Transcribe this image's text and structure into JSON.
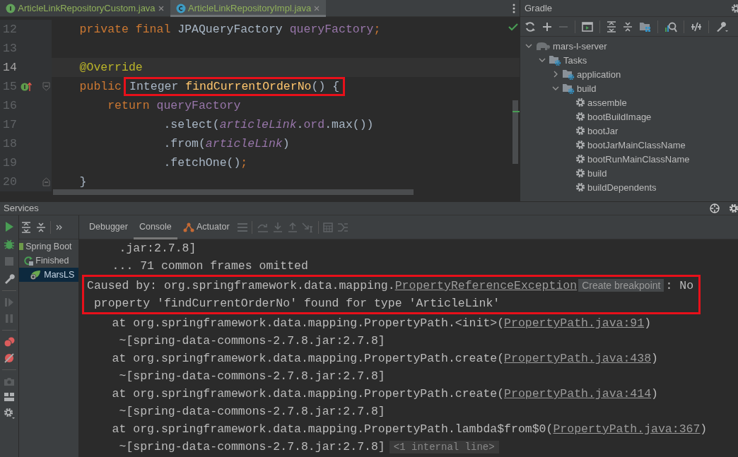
{
  "editor": {
    "tabs": [
      {
        "label": "ArticleLinkRepositoryCustom.java",
        "kind": "interface",
        "selected": false
      },
      {
        "label": "ArticleLinkRepositoryImpl.java",
        "kind": "class",
        "selected": true
      }
    ],
    "lines": [
      {
        "number": "12",
        "current": false,
        "implements": false,
        "fold_start": false,
        "fold_end": false,
        "segments": [
          {
            "boxed": false,
            "tokens": [
              {
                "text": "    private final ",
                "kind": "keyword"
              },
              {
                "text": "JPAQueryFactory ",
                "kind": "plain"
              },
              {
                "text": "queryFactory",
                "kind": "field"
              },
              {
                "text": ";",
                "kind": "keyword"
              }
            ]
          }
        ]
      },
      {
        "number": "13",
        "current": false,
        "implements": false,
        "fold_start": false,
        "fold_end": false
      },
      {
        "number": "14",
        "current": true,
        "implements": false,
        "fold_start": false,
        "fold_end": false,
        "segments": [
          {
            "boxed": false,
            "tokens": [
              {
                "text": "    @Override",
                "kind": "annotation"
              }
            ]
          }
        ]
      },
      {
        "number": "15",
        "current": false,
        "implements": true,
        "fold_start": true,
        "fold_end": false,
        "segments": [
          {
            "boxed": false,
            "tokens": [
              {
                "text": "    public",
                "kind": "keyword"
              }
            ]
          },
          {
            "boxed": true,
            "tokens": [
              {
                "text": "Integer ",
                "kind": "plain"
              },
              {
                "text": "findCurrentOrderNo",
                "kind": "method"
              },
              {
                "text": "() {",
                "kind": "plain"
              }
            ]
          }
        ]
      },
      {
        "number": "16",
        "current": false,
        "implements": false,
        "fold_start": false,
        "fold_end": false,
        "segments": [
          {
            "boxed": false,
            "tokens": [
              {
                "text": "        return ",
                "kind": "keyword"
              },
              {
                "text": "queryFactory",
                "kind": "field"
              }
            ]
          }
        ]
      },
      {
        "number": "17",
        "current": false,
        "implements": false,
        "fold_start": false,
        "fold_end": false,
        "segments": [
          {
            "boxed": false,
            "tokens": [
              {
                "text": "                .select(",
                "kind": "plain"
              },
              {
                "text": "articleLink",
                "kind": "static"
              },
              {
                "text": ".",
                "kind": "plain"
              },
              {
                "text": "ord",
                "kind": "field"
              },
              {
                "text": ".max())",
                "kind": "plain"
              }
            ]
          }
        ]
      },
      {
        "number": "18",
        "current": false,
        "implements": false,
        "fold_start": false,
        "fold_end": false,
        "segments": [
          {
            "boxed": false,
            "tokens": [
              {
                "text": "                .from(",
                "kind": "plain"
              },
              {
                "text": "articleLink",
                "kind": "static"
              },
              {
                "text": ")",
                "kind": "plain"
              }
            ]
          }
        ]
      },
      {
        "number": "19",
        "current": false,
        "implements": false,
        "fold_start": false,
        "fold_end": false,
        "segments": [
          {
            "boxed": false,
            "tokens": [
              {
                "text": "                .fetchOne()",
                "kind": "plain"
              },
              {
                "text": ";",
                "kind": "keyword"
              }
            ]
          }
        ]
      },
      {
        "number": "20",
        "current": false,
        "implements": false,
        "fold_start": false,
        "fold_end": true,
        "segments": [
          {
            "boxed": false,
            "tokens": [
              {
                "text": "    }",
                "kind": "plain"
              }
            ]
          }
        ]
      }
    ]
  },
  "gradle": {
    "title": "Gradle",
    "tree": [
      {
        "label": "mars-l-server",
        "kind": "project",
        "expanded": true,
        "children": [
          {
            "label": "Tasks",
            "kind": "folder",
            "expanded": true,
            "children": [
              {
                "label": "application",
                "kind": "folder",
                "expanded": false
              },
              {
                "label": "build",
                "kind": "folder",
                "expanded": true,
                "children": [
                  {
                    "label": "assemble",
                    "kind": "task"
                  },
                  {
                    "label": "bootBuildImage",
                    "kind": "task"
                  },
                  {
                    "label": "bootJar",
                    "kind": "task"
                  },
                  {
                    "label": "bootJarMainClassName",
                    "kind": "task"
                  },
                  {
                    "label": "bootRunMainClassName",
                    "kind": "task"
                  },
                  {
                    "label": "build",
                    "kind": "task"
                  },
                  {
                    "label": "buildDependents",
                    "kind": "task"
                  }
                ]
              }
            ]
          }
        ]
      }
    ]
  },
  "services": {
    "title": "Services",
    "tree": [
      {
        "label": "Spring Boot",
        "kind": "springboot",
        "selected": false,
        "children": [
          {
            "label": "Finished",
            "kind": "finished",
            "selected": false,
            "children": [
              {
                "label": "MarsLS",
                "kind": "app",
                "selected": true
              }
            ]
          }
        ]
      }
    ],
    "tabs": [
      {
        "label": "Debugger",
        "selected": false
      },
      {
        "label": "Console",
        "selected": true
      },
      {
        "label": "Actuator",
        "selected": false,
        "kind": "actuator"
      }
    ],
    "console": [
      {
        "boxed": false,
        "lines": [
          [
            {
              "text": "     .jar:2.7.8]",
              "kind": "plain"
            }
          ],
          [
            {
              "text": "    ... 71 common frames omitted",
              "kind": "plain"
            }
          ]
        ]
      },
      {
        "boxed": true,
        "lines": [
          [
            {
              "text": "Caused by: org.springframework.data.mapping.",
              "kind": "plain"
            },
            {
              "text": "PropertyReferenceException",
              "kind": "link"
            },
            {
              "text": "Create breakpoint",
              "kind": "chip"
            },
            {
              "text": ": No",
              "kind": "plain"
            }
          ],
          [
            {
              "text": " property 'findCurrentOrderNo' found for type 'ArticleLink'",
              "kind": "plain"
            }
          ]
        ]
      },
      {
        "boxed": false,
        "lines": [
          [
            {
              "text": "    at org.springframework.data.mapping.PropertyPath.<init>(",
              "kind": "plain"
            },
            {
              "text": "PropertyPath.java:91",
              "kind": "link"
            },
            {
              "text": ")",
              "kind": "plain"
            }
          ],
          [
            {
              "text": "     ~[spring-data-commons-2.7.8.jar:2.7.8]",
              "kind": "plain"
            }
          ],
          [
            {
              "text": "    at org.springframework.data.mapping.PropertyPath.create(",
              "kind": "plain"
            },
            {
              "text": "PropertyPath.java:438",
              "kind": "link"
            },
            {
              "text": ")",
              "kind": "plain"
            }
          ],
          [
            {
              "text": "     ~[spring-data-commons-2.7.8.jar:2.7.8]",
              "kind": "plain"
            }
          ],
          [
            {
              "text": "    at org.springframework.data.mapping.PropertyPath.create(",
              "kind": "plain"
            },
            {
              "text": "PropertyPath.java:414",
              "kind": "link"
            },
            {
              "text": ")",
              "kind": "plain"
            }
          ],
          [
            {
              "text": "     ~[spring-data-commons-2.7.8.jar:2.7.8]",
              "kind": "plain"
            }
          ],
          [
            {
              "text": "    at org.springframework.data.mapping.PropertyPath.lambda$from$0(",
              "kind": "plain"
            },
            {
              "text": "PropertyPath.java:367",
              "kind": "link"
            },
            {
              "text": ")",
              "kind": "plain"
            }
          ],
          [
            {
              "text": "     ~[spring-data-commons-2.7.8.jar:2.7.8]",
              "kind": "plain"
            },
            {
              "text": "<1 internal line>",
              "kind": "fold"
            }
          ]
        ]
      }
    ]
  }
}
